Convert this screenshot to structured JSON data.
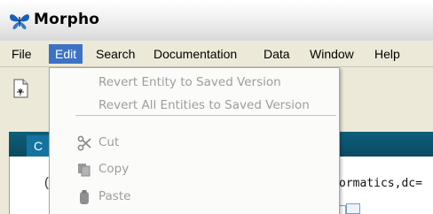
{
  "window": {
    "title": "Morpho",
    "logo_icon": "butterfly-logo-icon"
  },
  "menubar": {
    "items": [
      {
        "label": "File"
      },
      {
        "label": "Edit"
      },
      {
        "label": "Search"
      },
      {
        "label": "Documentation"
      },
      {
        "label": "Data"
      },
      {
        "label": "Window"
      },
      {
        "label": "Help"
      }
    ],
    "active": "Edit",
    "accent_color": "#3b72c4"
  },
  "toolbar": {
    "new_icon": "new-document-icon"
  },
  "background": {
    "tab_label": "C",
    "paren_text": "(",
    "text_fragment": "ormatics,dc=",
    "bar_color": "#0e5f7b"
  },
  "edit_menu": {
    "items": [
      {
        "label": "Revert Entity to Saved Version",
        "enabled": false
      },
      {
        "label": "Revert All Entities to Saved Version",
        "enabled": false
      },
      {
        "label": "Cut",
        "icon": "scissors-icon",
        "enabled": false
      },
      {
        "label": "Copy",
        "icon": "copy-icon",
        "enabled": false
      },
      {
        "label": "Paste",
        "icon": "paste-icon",
        "enabled": false
      }
    ],
    "disabled_color": "#9d9d9d"
  }
}
